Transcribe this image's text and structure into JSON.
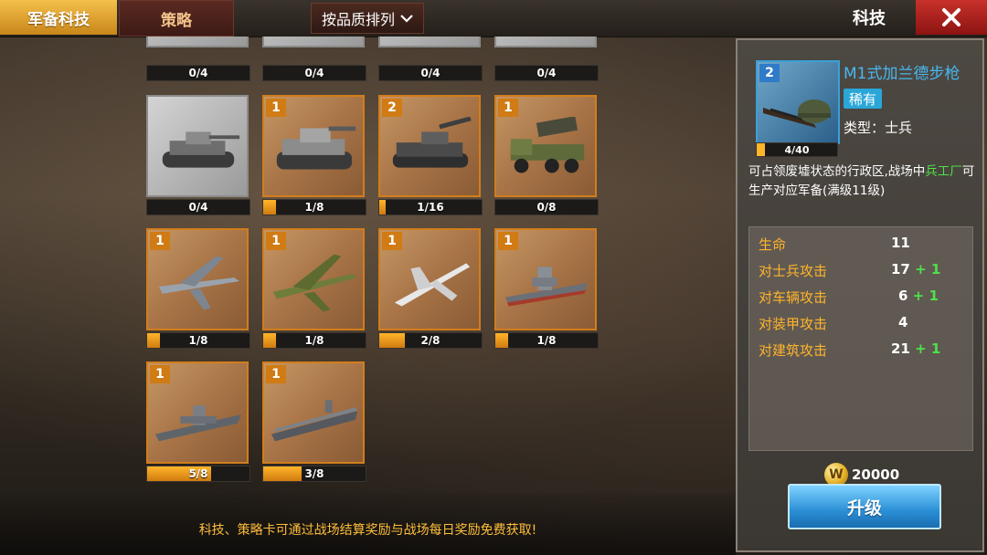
{
  "tabs": {
    "active": "军备科技",
    "normal": "策略"
  },
  "sort": {
    "label": "按品质排列"
  },
  "header": {
    "title": "科技"
  },
  "cards_top_row": [
    {
      "progress_text": "0/4",
      "fill": 0
    },
    {
      "progress_text": "0/4",
      "fill": 0
    },
    {
      "progress_text": "0/4",
      "fill": 0
    },
    {
      "progress_text": "0/4",
      "fill": 0
    }
  ],
  "cards": [
    {
      "badge": "",
      "unit": "tank-heavy",
      "progress_text": "0/4",
      "fill": 0,
      "locked": true
    },
    {
      "badge": "1",
      "unit": "tank-super",
      "progress_text": "1/8",
      "fill": 0.125
    },
    {
      "badge": "2",
      "unit": "tank-destroyer",
      "progress_text": "1/16",
      "fill": 0.0625
    },
    {
      "badge": "1",
      "unit": "rocket-truck",
      "progress_text": "0/8",
      "fill": 0
    },
    {
      "badge": "1",
      "unit": "bomber-gray",
      "progress_text": "1/8",
      "fill": 0.125
    },
    {
      "badge": "1",
      "unit": "bomber-green",
      "progress_text": "1/8",
      "fill": 0.125
    },
    {
      "badge": "1",
      "unit": "jet-white",
      "progress_text": "2/8",
      "fill": 0.25
    },
    {
      "badge": "1",
      "unit": "battleship",
      "progress_text": "1/8",
      "fill": 0.125
    },
    {
      "badge": "1",
      "unit": "cruiser",
      "progress_text": "5/8",
      "fill": 0.625
    },
    {
      "badge": "1",
      "unit": "carrier",
      "progress_text": "3/8",
      "fill": 0.375
    }
  ],
  "detail": {
    "badge": "2",
    "name": "M1式加兰德步枪",
    "rarity": "稀有",
    "type": "类型：士兵",
    "progress_text": "4/40",
    "progress_fill": 0.1,
    "desc_before": "可占领废墟状态的行政区,战场中",
    "desc_highlight": "兵工厂",
    "desc_after": "可生产对应军备(满级11级)",
    "stats": [
      {
        "label": "生命",
        "value": "11",
        "bonus": ""
      },
      {
        "label": "对士兵攻击",
        "value": "17",
        "bonus": "+ 1"
      },
      {
        "label": "对车辆攻击",
        "value": "6",
        "bonus": "+ 1"
      },
      {
        "label": "对装甲攻击",
        "value": "4",
        "bonus": ""
      },
      {
        "label": "对建筑攻击",
        "value": "21",
        "bonus": "+ 1"
      }
    ],
    "coin_symbol": "W",
    "cost": "20000",
    "upgrade_label": "升级"
  },
  "tip": "科技、策略卡可通过战场结算奖励与战场每日奖励免费获取!"
}
